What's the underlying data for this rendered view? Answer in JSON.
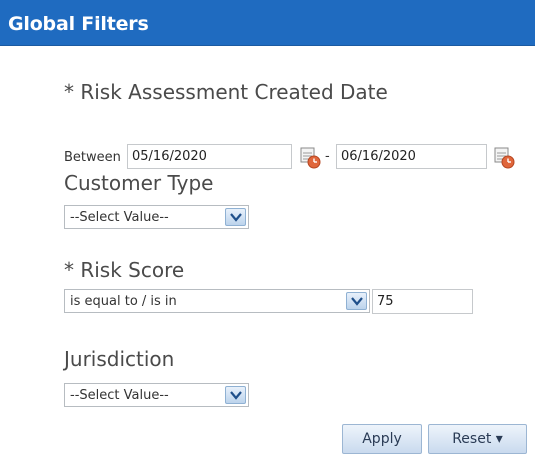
{
  "header": {
    "title": "Global Filters"
  },
  "risk_date": {
    "label": "* Risk Assessment Created Date",
    "between_label": "Between",
    "from_value": "05/16/2020",
    "separator": "-",
    "to_value": "06/16/2020"
  },
  "customer_type": {
    "label": "Customer Type",
    "selected": "--Select Value--"
  },
  "risk_score": {
    "label": "* Risk Score",
    "operator": "is equal to / is in",
    "value": "75"
  },
  "jurisdiction": {
    "label": "Jurisdiction",
    "selected": "--Select Value--"
  },
  "actions": {
    "apply_label": "Apply",
    "reset_label": "Reset ▾"
  }
}
